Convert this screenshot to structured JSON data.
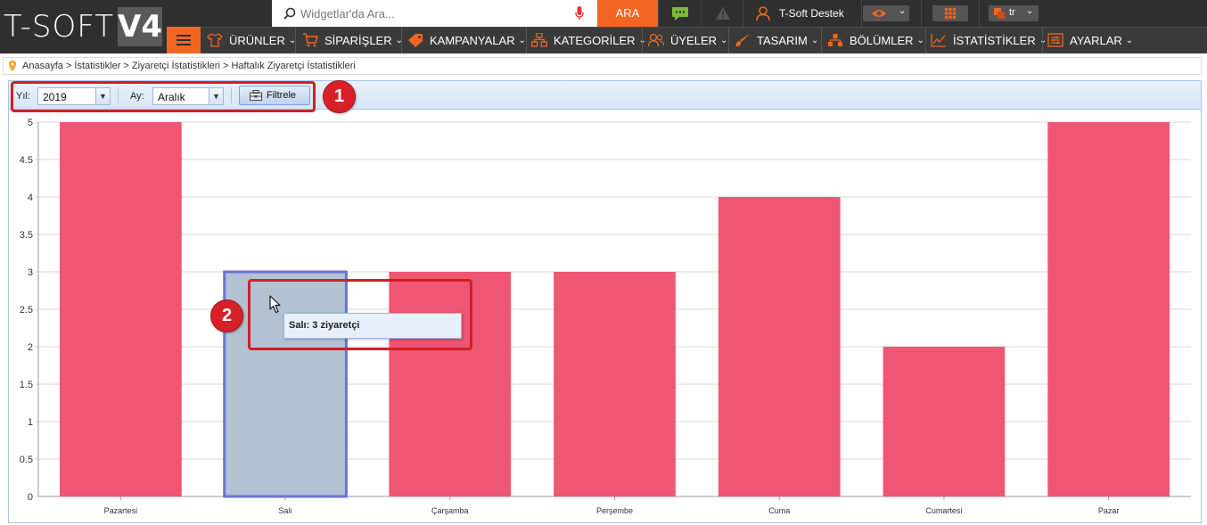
{
  "header": {
    "logo_text": "T-SOFT",
    "logo_version": "V4",
    "search_placeholder": "Widgetlar'da Ara...",
    "search_button": "ARA",
    "support_label": "T-Soft Destek",
    "language": "tr"
  },
  "menu": [
    {
      "label": "ÜRÜNLER",
      "icon": "shirt-icon"
    },
    {
      "label": "SİPARİŞLER",
      "icon": "cart-icon"
    },
    {
      "label": "KAMPANYALAR",
      "icon": "tag-icon"
    },
    {
      "label": "KATEGORİLER",
      "icon": "sitemap-icon"
    },
    {
      "label": "ÜYELER",
      "icon": "users-icon"
    },
    {
      "label": "TASARIM",
      "icon": "brush-icon"
    },
    {
      "label": "BÖLÜMLER",
      "icon": "blocks-icon"
    },
    {
      "label": "İSTATİSTİKLER",
      "icon": "chart-icon"
    },
    {
      "label": "AYARLAR",
      "icon": "settings-icon"
    }
  ],
  "breadcrumb": "Anasayfa > İstatistikler > Ziyaretçi İstatistikleri > Haftalık Ziyaretçi İstatistikleri",
  "filters": {
    "year_label": "Yıl:",
    "year_value": "2019",
    "month_label": "Ay:",
    "month_value": "Aralık",
    "filter_button": "Filtrele"
  },
  "annotations": {
    "badge1": "1",
    "badge2": "2"
  },
  "tooltip": "Salı: 3 ziyaretçi",
  "colors": {
    "bar": "#ef5673",
    "bar_hover": "#b2c2d3",
    "bar_hover_border": "#6b73d8",
    "accent": "#f26522"
  },
  "chart_data": {
    "type": "bar",
    "categories": [
      "Pazartesi",
      "Salı",
      "Çarşamba",
      "Perşembe",
      "Cuma",
      "Cumartesi",
      "Pazar"
    ],
    "values": [
      5,
      3,
      3,
      3,
      4,
      2,
      5
    ],
    "ylim": [
      0,
      5
    ],
    "yticks": [
      "0",
      "0.5",
      "1",
      "1.5",
      "2",
      "2.5",
      "3",
      "3.5",
      "4",
      "4.5",
      "5"
    ],
    "highlighted_category": "Salı",
    "grid": true
  }
}
